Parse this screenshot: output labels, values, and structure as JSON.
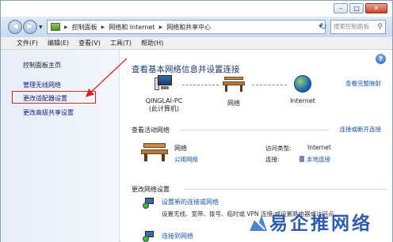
{
  "window": {
    "minimize_glyph": "–",
    "maximize_glyph": "□",
    "close_glyph": "✕"
  },
  "address_bar": {
    "crumbs": [
      "控制面板",
      "网络和 Internet",
      "网络和共享中心"
    ],
    "search_placeholder": "搜索控制面板"
  },
  "menu": {
    "items": [
      "文件(F)",
      "编辑(E)",
      "查看(V)",
      "工具(T)",
      "帮助(H)"
    ]
  },
  "left_pane": {
    "home": "控制面板主页",
    "items": [
      "管理无线网络",
      "更改适配器设置",
      "更改高级共享设置"
    ]
  },
  "main": {
    "help_glyph": "?",
    "title": "查看基本网络信息并设置连接",
    "view_full_map": "查看完整映射",
    "map": {
      "pc_name": "QINGLAI-PC",
      "pc_sub": "(此计算机)",
      "network": "网络",
      "internet": "Internet"
    },
    "active_networks_header": "查看活动网络",
    "connect_disconnect": "连接或断开连接",
    "active_network": {
      "name": "网络",
      "type": "公用网络",
      "access_type_label": "访问类型:",
      "access_type_value": "Internet",
      "connection_label": "连接:",
      "connection_value": "本地连接"
    },
    "change_settings_header": "更改网络设置",
    "tasks": [
      {
        "link": "设置新的连接或网络",
        "desc": "设置无线、宽带、拨号、临时或 VPN 连接;或设置路由器或访问点。"
      },
      {
        "link": "连接到网络"
      }
    ]
  },
  "watermark": {
    "text": "易企推网络"
  },
  "colors": {
    "link": "#1a54a8",
    "title": "#1d3c6e",
    "highlight": "#dd2222",
    "watermark": "#1d4fa8"
  }
}
